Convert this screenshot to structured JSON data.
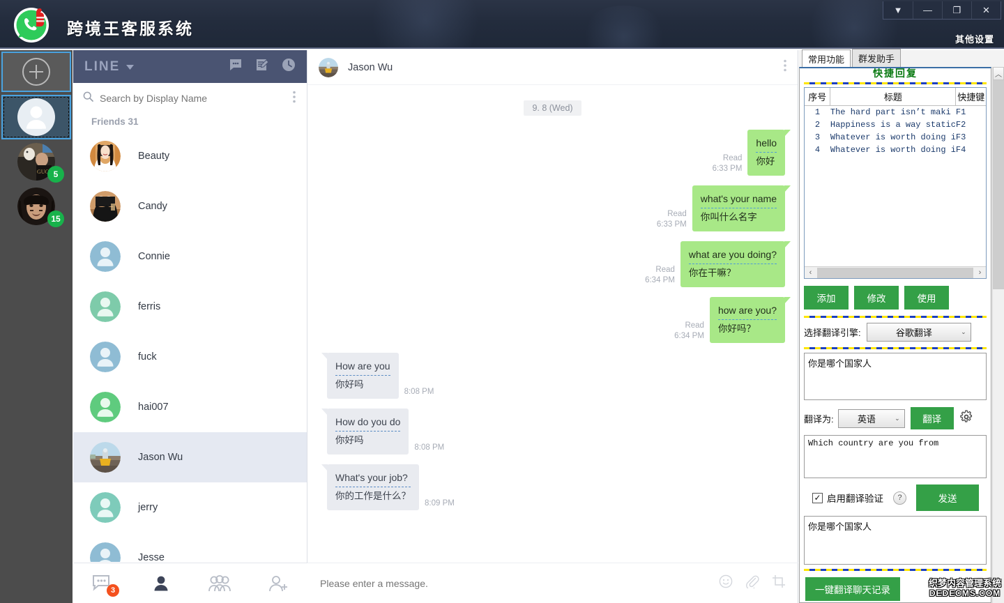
{
  "titlebar": {
    "app_title": "跨境王客服系统",
    "other_settings": "其他设置",
    "controls": [
      {
        "name": "collapse",
        "glyph": "▼"
      },
      {
        "name": "minimize",
        "glyph": "—"
      },
      {
        "name": "maximize",
        "glyph": "❐"
      },
      {
        "name": "close",
        "glyph": "✕"
      }
    ]
  },
  "account_rail": {
    "add_label": "+",
    "accounts": [
      {
        "name": "account-placeholder",
        "badge": ""
      },
      {
        "name": "account-gucci",
        "badge": "5"
      },
      {
        "name": "account-man",
        "badge": "15"
      }
    ]
  },
  "contacts": {
    "service_name": "LINE",
    "search_placeholder": "Search by Display Name",
    "search_value": "",
    "group_label": "Friends 31",
    "header_icons": [
      "chat-icon",
      "compose-icon",
      "history-icon"
    ],
    "more_icon": "more-vertical-icon",
    "items": [
      {
        "name": "Beauty",
        "avatar": "photo-beauty",
        "selected": false
      },
      {
        "name": "Candy",
        "avatar": "photo-candy",
        "selected": false
      },
      {
        "name": "Connie",
        "avatar": "default-blue",
        "selected": false
      },
      {
        "name": "ferris",
        "avatar": "default-green",
        "selected": false
      },
      {
        "name": "fuck",
        "avatar": "default-blue",
        "selected": false
      },
      {
        "name": "hai007",
        "avatar": "default-green2",
        "selected": false
      },
      {
        "name": "Jason Wu",
        "avatar": "photo-jason",
        "selected": true
      },
      {
        "name": "jerry",
        "avatar": "default-teal",
        "selected": false
      },
      {
        "name": "Jesse",
        "avatar": "default-blue",
        "selected": false
      }
    ],
    "tabs": [
      {
        "name": "tab-chats",
        "icon": "chat-bubble-icon",
        "badge": "3"
      },
      {
        "name": "tab-friends",
        "icon": "person-icon",
        "badge": ""
      },
      {
        "name": "tab-groups",
        "icon": "group-icon",
        "badge": ""
      },
      {
        "name": "tab-add-friend",
        "icon": "person-add-icon",
        "badge": ""
      }
    ]
  },
  "chat": {
    "contact_name": "Jason Wu",
    "more_icon": "more-vertical-icon",
    "day_separator": "9. 8 (Wed)",
    "messages": [
      {
        "dir": "out",
        "en": "hello",
        "zh": "你好",
        "status": "Read",
        "time": "6:33 PM"
      },
      {
        "dir": "out",
        "en": "what's your name",
        "zh": "你叫什么名字",
        "status": "Read",
        "time": "6:33 PM"
      },
      {
        "dir": "out",
        "en": "what are you doing?",
        "zh": "你在干嘛？",
        "status": "Read",
        "time": "6:34 PM"
      },
      {
        "dir": "out",
        "en": "how are you?",
        "zh": "你好吗？",
        "status": "Read",
        "time": "6:34 PM"
      },
      {
        "dir": "in",
        "en": "How are you",
        "zh": "你好吗",
        "status": "",
        "time": "8:08 PM"
      },
      {
        "dir": "in",
        "en": "How do you do",
        "zh": "你好吗",
        "status": "",
        "time": "8:08 PM"
      },
      {
        "dir": "in",
        "en": "What's your job?",
        "zh": "你的工作是什么？",
        "status": "",
        "time": "8:09 PM"
      }
    ],
    "composer_placeholder": "Please enter a message.",
    "composer_value": "",
    "composer_icons": [
      "emoji-icon",
      "attachment-icon",
      "screenshot-icon"
    ]
  },
  "tools": {
    "tabs": [
      {
        "label": "常用功能",
        "active": true
      },
      {
        "label": "群发助手",
        "active": false
      }
    ],
    "quick_reply_title": "快捷回复",
    "table": {
      "headers": [
        "序号",
        "标题",
        "快捷键"
      ],
      "rows": [
        [
          "1",
          "The hard part isn’t maki",
          "F1"
        ],
        [
          "2",
          "Happiness is a way static",
          "F2"
        ],
        [
          "3",
          "Whatever is worth doing i",
          "F3"
        ],
        [
          "4",
          "Whatever is worth doing i",
          "F4"
        ]
      ]
    },
    "hscroll": {
      "left_arrow": "‹",
      "right_arrow": "›"
    },
    "buttons": {
      "add": "添加",
      "edit": "修改",
      "use": "使用"
    },
    "engine_label": "选择翻译引擎:",
    "engine_value": "谷歌翻译",
    "source_text": "你是哪个国家人",
    "translate_to_label": "翻译为:",
    "translate_to_value": "英语",
    "translate_button": "翻译",
    "settings_icon": "gear-icon",
    "result_text": "Which country are you from",
    "verify_checkbox_label": "启用翻译验证",
    "verify_checked": true,
    "help_icon": "question-icon",
    "send_button": "发送",
    "verify_text": "你是哪个国家人",
    "translate_log_button": "一键翻译聊天记录",
    "vscroll_up": "︿"
  },
  "watermark": {
    "line1": "织梦内容管理系统",
    "line2": "DEDECMS.COM"
  },
  "colors": {
    "titlebar": "#232c3d",
    "accent_green": "#34a047",
    "bubble_out": "#a8e887",
    "bubble_in": "#e9ebf0",
    "line_header": "#4a5472",
    "badge_red": "#f4511e",
    "badge_green": "#18b24b",
    "qr_title_green": "#0a7a12"
  }
}
